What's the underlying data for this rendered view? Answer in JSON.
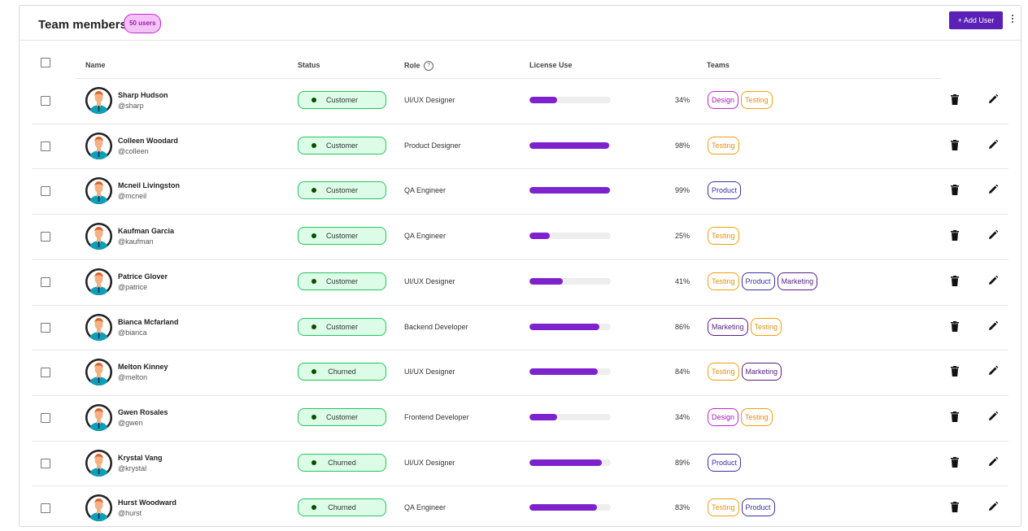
{
  "header": {
    "title": "Team members",
    "count_badge": "50 users",
    "add_button": "+ Add User"
  },
  "columns": {
    "name": "Name",
    "status": "Status",
    "role": "Role",
    "role_help": "?",
    "license": "License Use",
    "teams": "Teams"
  },
  "colors": {
    "accent": "#5b21b6",
    "bar": "#7e22ce",
    "status_border": "#22c55e",
    "status_bg": "#dcfce7"
  },
  "team_colors": {
    "Design": {
      "border": "#c026d3",
      "text": "#a21caf"
    },
    "Testing": {
      "border": "#f59e0b",
      "text": "#e09212"
    },
    "Product": {
      "border": "#3730a3",
      "text": "#3730a3"
    },
    "Marketing": {
      "border": "#581c87",
      "text": "#581c87"
    }
  },
  "rows": [
    {
      "name": "Sharp Hudson",
      "handle": "@sharp",
      "status": "Customer",
      "role": "UI/UX Designer",
      "license": 34,
      "license_label": "34%",
      "teams": [
        "Design",
        "Testing"
      ]
    },
    {
      "name": "Colleen Woodard",
      "handle": "@colleen",
      "status": "Customer",
      "role": "Product Designer",
      "license": 98,
      "license_label": "98%",
      "teams": [
        "Testing"
      ]
    },
    {
      "name": "Mcneil Livingston",
      "handle": "@mcneil",
      "status": "Customer",
      "role": "QA Engineer",
      "license": 99,
      "license_label": "99%",
      "teams": [
        "Product"
      ]
    },
    {
      "name": "Kaufman Garcia",
      "handle": "@kaufman",
      "status": "Customer",
      "role": "QA Engineer",
      "license": 25,
      "license_label": "25%",
      "teams": [
        "Testing"
      ]
    },
    {
      "name": "Patrice Glover",
      "handle": "@patrice",
      "status": "Customer",
      "role": "UI/UX Designer",
      "license": 41,
      "license_label": "41%",
      "teams": [
        "Testing",
        "Product",
        "Marketing"
      ]
    },
    {
      "name": "Bianca Mcfarland",
      "handle": "@bianca",
      "status": "Customer",
      "role": "Backend Developer",
      "license": 86,
      "license_label": "86%",
      "teams": [
        "Marketing",
        "Testing"
      ]
    },
    {
      "name": "Melton Kinney",
      "handle": "@melton",
      "status": "Churned",
      "role": "UI/UX Designer",
      "license": 84,
      "license_label": "84%",
      "teams": [
        "Testing",
        "Marketing"
      ]
    },
    {
      "name": "Gwen Rosales",
      "handle": "@gwen",
      "status": "Customer",
      "role": "Frontend Developer",
      "license": 34,
      "license_label": "34%",
      "teams": [
        "Design",
        "Testing"
      ]
    },
    {
      "name": "Krystal Vang",
      "handle": "@krystal",
      "status": "Churned",
      "role": "UI/UX Designer",
      "license": 89,
      "license_label": "89%",
      "teams": [
        "Product"
      ]
    },
    {
      "name": "Hurst Woodward",
      "handle": "@hurst",
      "status": "Churned",
      "role": "QA Engineer",
      "license": 83,
      "license_label": "83%",
      "teams": [
        "Testing",
        "Product"
      ]
    }
  ]
}
